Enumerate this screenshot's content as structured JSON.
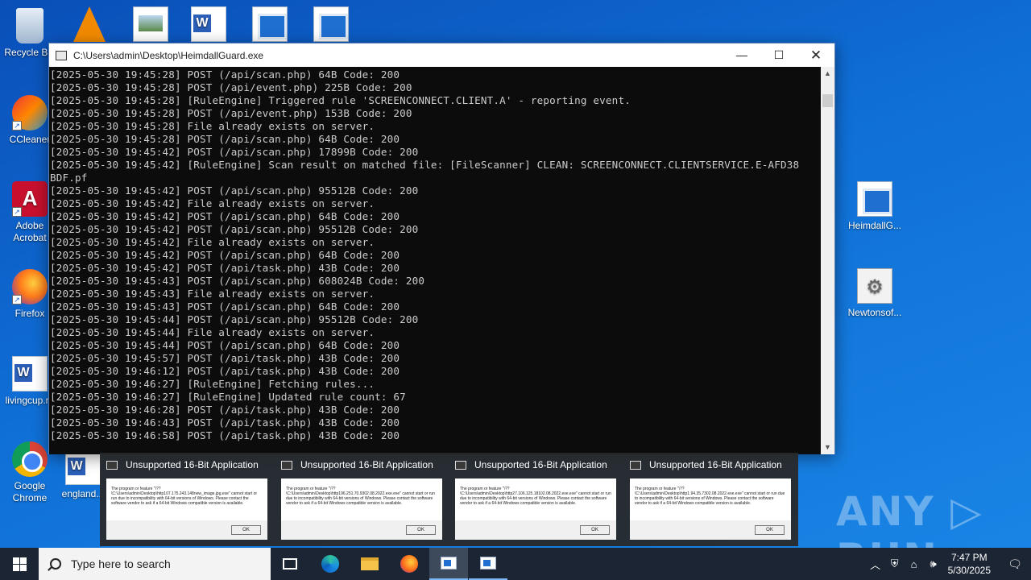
{
  "desktop": {
    "icons_left": [
      {
        "label": "Recycle Bin",
        "icon": "recycle-bin-icon"
      },
      {
        "label": "CCleaner",
        "icon": "ccleaner-icon"
      },
      {
        "label": "Adobe Acrobat",
        "icon": "adobe-acrobat-icon"
      },
      {
        "label": "Firefox",
        "icon": "firefox-icon"
      },
      {
        "label": "livingcup.rtf",
        "icon": "word-document-icon"
      },
      {
        "label": "Google Chrome",
        "icon": "chrome-icon"
      },
      {
        "label": "england...",
        "icon": "word-document-icon"
      }
    ],
    "icons_right": [
      {
        "label": "HeimdallG...",
        "icon": "exe-window-icon"
      },
      {
        "label": "Newtonsof...",
        "icon": "settings-file-icon"
      }
    ]
  },
  "console_window": {
    "title": "C:\\Users\\admin\\Desktop\\HeimdallGuard.exe",
    "minimize": "—",
    "maximize": "☐",
    "close": "✕",
    "lines": [
      "[2025-05-30 19:45:28] POST (/api/scan.php) 64B Code: 200",
      "[2025-05-30 19:45:28] POST (/api/event.php) 225B Code: 200",
      "[2025-05-30 19:45:28] [RuleEngine] Triggered rule 'SCREENCONNECT.CLIENT.A' - reporting event.",
      "[2025-05-30 19:45:28] POST (/api/event.php) 153B Code: 200",
      "[2025-05-30 19:45:28] File already exists on server.",
      "[2025-05-30 19:45:28] POST (/api/scan.php) 64B Code: 200",
      "[2025-05-30 19:45:42] POST (/api/scan.php) 17899B Code: 200",
      "[2025-05-30 19:45:42] [RuleEngine] Scan result on matched file: [FileScanner] CLEAN: SCREENCONNECT.CLIENTSERVICE.E-AFD38",
      "BDF.pf",
      "[2025-05-30 19:45:42] POST (/api/scan.php) 95512B Code: 200",
      "[2025-05-30 19:45:42] File already exists on server.",
      "[2025-05-30 19:45:42] POST (/api/scan.php) 64B Code: 200",
      "[2025-05-30 19:45:42] POST (/api/scan.php) 95512B Code: 200",
      "[2025-05-30 19:45:42] File already exists on server.",
      "[2025-05-30 19:45:42] POST (/api/scan.php) 64B Code: 200",
      "[2025-05-30 19:45:42] POST (/api/task.php) 43B Code: 200",
      "[2025-05-30 19:45:43] POST (/api/scan.php) 608024B Code: 200",
      "[2025-05-30 19:45:43] File already exists on server.",
      "[2025-05-30 19:45:43] POST (/api/scan.php) 64B Code: 200",
      "[2025-05-30 19:45:44] POST (/api/scan.php) 95512B Code: 200",
      "[2025-05-30 19:45:44] File already exists on server.",
      "[2025-05-30 19:45:44] POST (/api/scan.php) 64B Code: 200",
      "[2025-05-30 19:45:57] POST (/api/task.php) 43B Code: 200",
      "[2025-05-30 19:46:12] POST (/api/task.php) 43B Code: 200",
      "[2025-05-30 19:46:27] [RuleEngine] Fetching rules...",
      "[2025-05-30 19:46:27] [RuleEngine] Updated rule count: 67",
      "[2025-05-30 19:46:28] POST (/api/task.php) 43B Code: 200",
      "[2025-05-30 19:46:43] POST (/api/task.php) 43B Code: 200",
      "[2025-05-30 19:46:58] POST (/api/task.php) 43B Code: 200"
    ]
  },
  "thumbnails": [
    {
      "title": "Unsupported 16-Bit Application",
      "message": "The program or feature \"\\??\\C:\\Users\\admin\\Desktop\\http107.175.243.148new_image.jpg.exe\" cannot start or run due to incompatibility with 64-bit versions of Windows. Please contact the software vendor to ask if a 64-bit Windows compatible version is available.",
      "ok": "OK"
    },
    {
      "title": "Unsupported 16-Bit Application",
      "message": "The program or feature \"\\??\\C:\\Users\\admin\\Desktop\\http196.251.70.9302.08.2022.exe.exe\" cannot start or run due to incompatibility with 64-bit versions of Windows. Please contact the software vendor to ask if a 64-bit Windows compatible version is available.",
      "ok": "OK"
    },
    {
      "title": "Unsupported 16-Bit Application",
      "message": "The program or feature \"\\??\\C:\\Users\\admin\\Desktop\\http27.106.125.18102.08.2022.exe.exe\" cannot start or run due to incompatibility with 64-bit versions of Windows. Please contact the software vendor to ask if a 64-bit Windows compatible version is available.",
      "ok": "OK"
    },
    {
      "title": "Unsupported 16-Bit Application",
      "message": "The program or feature \"\\??\\C:\\Users\\admin\\Desktop\\http1.94.35.7302.08.2022.exe.exe\" cannot start or run due to incompatibility with 64-bit versions of Windows. Please contact the software vendor to ask if a 64-bit Windows compatible version is available.",
      "ok": "OK"
    }
  ],
  "watermark": "ANY ▷ RUN",
  "taskbar": {
    "search_placeholder": "Type here to search",
    "time": "7:47 PM",
    "date": "5/30/2025",
    "tray_icons": [
      "chevron-up-icon",
      "security-icon",
      "network-icon",
      "volume-icon"
    ],
    "tray_glyphs": [
      "︿",
      "⛨",
      "⌂",
      "🕪"
    ],
    "notification_glyph": "🗨"
  }
}
